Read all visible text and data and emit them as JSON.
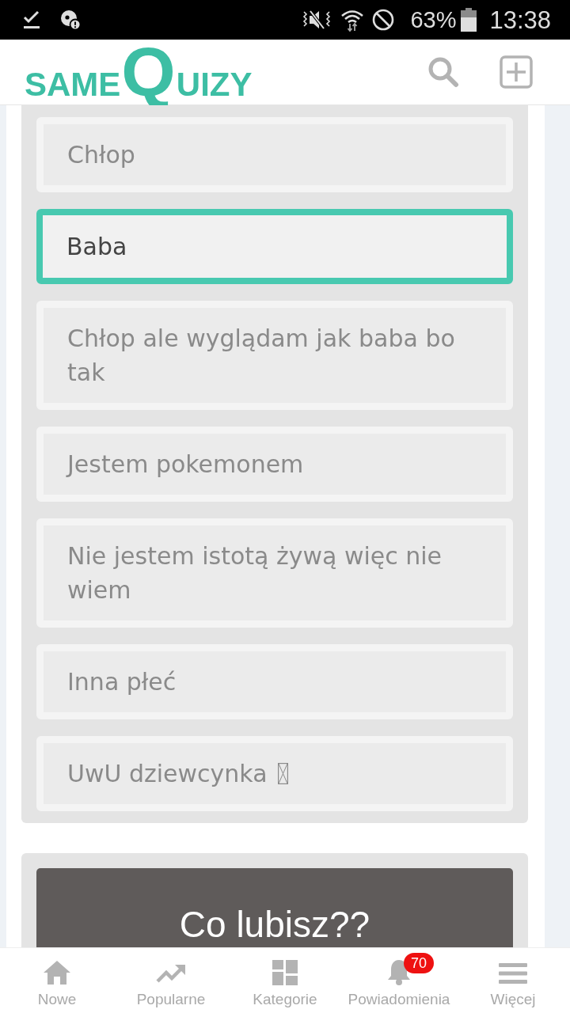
{
  "status_bar": {
    "battery_percent": "63%",
    "time": "13:38"
  },
  "header": {
    "logo": [
      {
        "text": "SAME",
        "kind": "small"
      },
      {
        "text": "Q",
        "kind": "large"
      },
      {
        "text": "UIZY",
        "kind": "small"
      }
    ]
  },
  "answer_options": [
    {
      "text": "Chłop",
      "selected": false,
      "kind": "plain"
    },
    {
      "text": "Baba",
      "selected": true,
      "kind": "plain"
    },
    {
      "text": "Chłop ale wyglądam jak baba bo tak",
      "selected": false,
      "kind": "plain"
    },
    {
      "text": "Jestem pokemonem",
      "selected": false,
      "kind": "plain"
    },
    {
      "text": "Nie jestem istotą żywą więc nie wiem",
      "selected": false,
      "kind": "plain"
    },
    {
      "text": "Inna płeć",
      "selected": false,
      "kind": "plain"
    },
    {
      "text": "UwU dziewcynka",
      "selected": false,
      "kind": "missing_glyph"
    }
  ],
  "next_question": {
    "title": "Co lubisz??"
  },
  "bottom_nav": [
    {
      "label": "Nowe"
    },
    {
      "label": "Popularne"
    },
    {
      "label": "Kategorie"
    },
    {
      "label": "Powiadomienia",
      "badge": "70"
    },
    {
      "label": "Więcej"
    }
  ]
}
